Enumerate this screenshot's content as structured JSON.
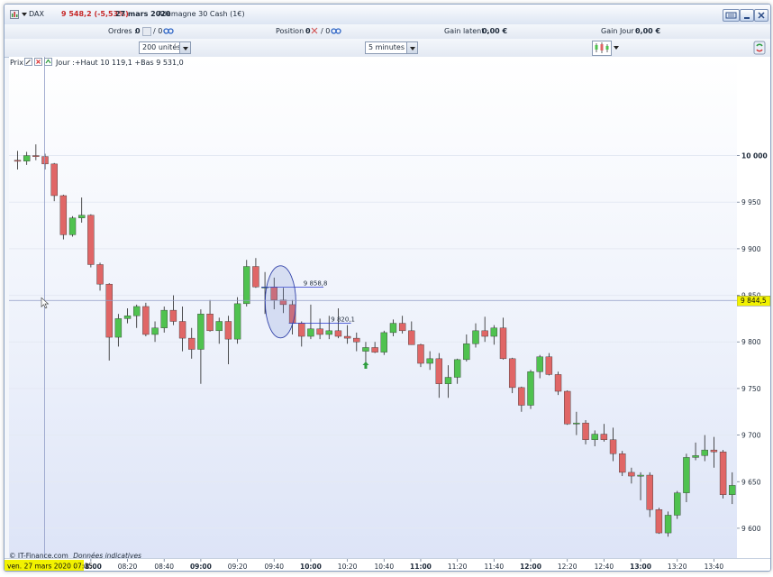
{
  "titlebar": {
    "symbol": "DAX",
    "price_change": "9 548,2 (-5,53%)",
    "date": "27 mars 2020",
    "instrument": "Allemagne 30 Cash (1€)"
  },
  "orders": {
    "label": "Ordres :",
    "value1": "0",
    "value2": "/ 0"
  },
  "position": {
    "label": "Position :",
    "value1": "0",
    "value2": "/ 0"
  },
  "gain_latent": {
    "label": "Gain latent :",
    "value": "0,00 €"
  },
  "gain_jour": {
    "label": "Gain Jour :",
    "value": "0,00 €"
  },
  "units_select": {
    "value": "200 unités"
  },
  "timeframe_select": {
    "value": "5 minutes"
  },
  "chart_header": {
    "label": "Prix",
    "info": "Jour :+Haut 10 119,1 +Bas 9 531,0"
  },
  "footer": {
    "copyright": "© IT-Finance.com",
    "note": "Données indicatives"
  },
  "colors": {
    "up": "#4fc24f",
    "down": "#e06666",
    "crosshair": "#8f9bc6",
    "current_price_bg": "#f2f200"
  },
  "chart_data": {
    "type": "candlestick",
    "title": "",
    "xlabel": "",
    "ylabel": "",
    "ylim": [
      9568,
      10106
    ],
    "y_ticks": [
      10000,
      9950,
      9900,
      9850,
      9800,
      9750,
      9700,
      9650,
      9600
    ],
    "y_tick_labels": [
      "10 000",
      "9 950",
      "9 900",
      "9 850",
      "9 800",
      "9 750",
      "9 700",
      "9 650",
      "9 600"
    ],
    "x_ticks": [
      {
        "label": "08:00",
        "bold": true,
        "idx": 8
      },
      {
        "label": "08:20",
        "bold": false,
        "idx": 12
      },
      {
        "label": "08:40",
        "bold": false,
        "idx": 16
      },
      {
        "label": "09:00",
        "bold": true,
        "idx": 20
      },
      {
        "label": "09:20",
        "bold": false,
        "idx": 24
      },
      {
        "label": "09:40",
        "bold": false,
        "idx": 28
      },
      {
        "label": "10:00",
        "bold": true,
        "idx": 32
      },
      {
        "label": "10:20",
        "bold": false,
        "idx": 36
      },
      {
        "label": "10:40",
        "bold": false,
        "idx": 40
      },
      {
        "label": "11:00",
        "bold": true,
        "idx": 44
      },
      {
        "label": "11:20",
        "bold": false,
        "idx": 48
      },
      {
        "label": "11:40",
        "bold": false,
        "idx": 52
      },
      {
        "label": "12:00",
        "bold": true,
        "idx": 56
      },
      {
        "label": "12:20",
        "bold": false,
        "idx": 60
      },
      {
        "label": "12:40",
        "bold": false,
        "idx": 64
      },
      {
        "label": "13:00",
        "bold": true,
        "idx": 68
      },
      {
        "label": "13:20",
        "bold": false,
        "idx": 72
      },
      {
        "label": "13:40",
        "bold": false,
        "idx": 76
      }
    ],
    "candles": [
      {
        "o": 9995,
        "h": 10005,
        "l": 9985,
        "c": 9994
      },
      {
        "o": 9994,
        "h": 10004,
        "l": 9990,
        "c": 10000
      },
      {
        "o": 10000,
        "h": 10012,
        "l": 9995,
        "c": 9999
      },
      {
        "o": 9999,
        "h": 10002,
        "l": 9985,
        "c": 9991
      },
      {
        "o": 9991,
        "h": 9992,
        "l": 9951,
        "c": 9957
      },
      {
        "o": 9957,
        "h": 9958,
        "l": 9910,
        "c": 9915
      },
      {
        "o": 9915,
        "h": 9935,
        "l": 9913,
        "c": 9933
      },
      {
        "o": 9933,
        "h": 9955,
        "l": 9928,
        "c": 9936
      },
      {
        "o": 9936,
        "h": 9937,
        "l": 9880,
        "c": 9883
      },
      {
        "o": 9883,
        "h": 9885,
        "l": 9855,
        "c": 9862
      },
      {
        "o": 9862,
        "h": 9863,
        "l": 9780,
        "c": 9805
      },
      {
        "o": 9805,
        "h": 9830,
        "l": 9795,
        "c": 9825
      },
      {
        "o": 9825,
        "h": 9836,
        "l": 9820,
        "c": 9828
      },
      {
        "o": 9828,
        "h": 9840,
        "l": 9815,
        "c": 9838
      },
      {
        "o": 9838,
        "h": 9842,
        "l": 9806,
        "c": 9808
      },
      {
        "o": 9808,
        "h": 9822,
        "l": 9800,
        "c": 9815
      },
      {
        "o": 9815,
        "h": 9838,
        "l": 9810,
        "c": 9834
      },
      {
        "o": 9834,
        "h": 9850,
        "l": 9818,
        "c": 9822
      },
      {
        "o": 9822,
        "h": 9838,
        "l": 9790,
        "c": 9804
      },
      {
        "o": 9804,
        "h": 9815,
        "l": 9782,
        "c": 9792
      },
      {
        "o": 9792,
        "h": 9835,
        "l": 9755,
        "c": 9830
      },
      {
        "o": 9830,
        "h": 9845,
        "l": 9811,
        "c": 9812
      },
      {
        "o": 9812,
        "h": 9826,
        "l": 9798,
        "c": 9822
      },
      {
        "o": 9822,
        "h": 9828,
        "l": 9776,
        "c": 9803
      },
      {
        "o": 9803,
        "h": 9848,
        "l": 9798,
        "c": 9841
      },
      {
        "o": 9841,
        "h": 9888,
        "l": 9838,
        "c": 9881
      },
      {
        "o": 9881,
        "h": 9890,
        "l": 9858,
        "c": 9859
      },
      {
        "o": 9859,
        "h": 9875,
        "l": 9830,
        "c": 9859
      },
      {
        "o": 9859,
        "h": 9869,
        "l": 9835,
        "c": 9845
      },
      {
        "o": 9845,
        "h": 9858,
        "l": 9831,
        "c": 9840
      },
      {
        "o": 9840,
        "h": 9845,
        "l": 9808,
        "c": 9820
      },
      {
        "o": 9820,
        "h": 9822,
        "l": 9795,
        "c": 9806
      },
      {
        "o": 9806,
        "h": 9840,
        "l": 9803,
        "c": 9814
      },
      {
        "o": 9814,
        "h": 9825,
        "l": 9803,
        "c": 9808
      },
      {
        "o": 9808,
        "h": 9828,
        "l": 9803,
        "c": 9812
      },
      {
        "o": 9812,
        "h": 9836,
        "l": 9804,
        "c": 9806
      },
      {
        "o": 9806,
        "h": 9818,
        "l": 9798,
        "c": 9804
      },
      {
        "o": 9804,
        "h": 9810,
        "l": 9790,
        "c": 9800
      },
      {
        "o": 9790,
        "h": 9800,
        "l": 9778,
        "c": 9794
      },
      {
        "o": 9794,
        "h": 9800,
        "l": 9788,
        "c": 9789
      },
      {
        "o": 9789,
        "h": 9812,
        "l": 9786,
        "c": 9810
      },
      {
        "o": 9810,
        "h": 9824,
        "l": 9806,
        "c": 9820
      },
      {
        "o": 9820,
        "h": 9828,
        "l": 9809,
        "c": 9812
      },
      {
        "o": 9812,
        "h": 9822,
        "l": 9797,
        "c": 9797
      },
      {
        "o": 9797,
        "h": 9798,
        "l": 9773,
        "c": 9777
      },
      {
        "o": 9777,
        "h": 9790,
        "l": 9770,
        "c": 9782
      },
      {
        "o": 9782,
        "h": 9788,
        "l": 9740,
        "c": 9755
      },
      {
        "o": 9755,
        "h": 9775,
        "l": 9740,
        "c": 9762
      },
      {
        "o": 9762,
        "h": 9782,
        "l": 9755,
        "c": 9781
      },
      {
        "o": 9781,
        "h": 9808,
        "l": 9779,
        "c": 9798
      },
      {
        "o": 9798,
        "h": 9820,
        "l": 9794,
        "c": 9812
      },
      {
        "o": 9812,
        "h": 9827,
        "l": 9800,
        "c": 9806
      },
      {
        "o": 9806,
        "h": 9818,
        "l": 9797,
        "c": 9815
      },
      {
        "o": 9815,
        "h": 9826,
        "l": 9781,
        "c": 9782
      },
      {
        "o": 9782,
        "h": 9783,
        "l": 9745,
        "c": 9751
      },
      {
        "o": 9751,
        "h": 9752,
        "l": 9725,
        "c": 9732
      },
      {
        "o": 9732,
        "h": 9770,
        "l": 9728,
        "c": 9768
      },
      {
        "o": 9768,
        "h": 9786,
        "l": 9761,
        "c": 9784
      },
      {
        "o": 9784,
        "h": 9788,
        "l": 9764,
        "c": 9765
      },
      {
        "o": 9765,
        "h": 9768,
        "l": 9743,
        "c": 9747
      },
      {
        "o": 9747,
        "h": 9748,
        "l": 9711,
        "c": 9712
      },
      {
        "o": 9712,
        "h": 9725,
        "l": 9700,
        "c": 9713
      },
      {
        "o": 9713,
        "h": 9716,
        "l": 9690,
        "c": 9695
      },
      {
        "o": 9695,
        "h": 9705,
        "l": 9688,
        "c": 9701
      },
      {
        "o": 9701,
        "h": 9712,
        "l": 9693,
        "c": 9695
      },
      {
        "o": 9695,
        "h": 9708,
        "l": 9672,
        "c": 9680
      },
      {
        "o": 9680,
        "h": 9683,
        "l": 9656,
        "c": 9660
      },
      {
        "o": 9660,
        "h": 9665,
        "l": 9648,
        "c": 9656
      },
      {
        "o": 9656,
        "h": 9660,
        "l": 9630,
        "c": 9657
      },
      {
        "o": 9657,
        "h": 9660,
        "l": 9612,
        "c": 9620
      },
      {
        "o": 9620,
        "h": 9622,
        "l": 9594,
        "c": 9595
      },
      {
        "o": 9595,
        "h": 9618,
        "l": 9591,
        "c": 9614
      },
      {
        "o": 9614,
        "h": 9640,
        "l": 9610,
        "c": 9638
      },
      {
        "o": 9638,
        "h": 9680,
        "l": 9628,
        "c": 9676
      },
      {
        "o": 9676,
        "h": 9692,
        "l": 9673,
        "c": 9678
      },
      {
        "o": 9678,
        "h": 9700,
        "l": 9672,
        "c": 9684
      },
      {
        "o": 9684,
        "h": 9698,
        "l": 9665,
        "c": 9682
      },
      {
        "o": 9682,
        "h": 9684,
        "l": 9632,
        "c": 9636
      },
      {
        "o": 9636,
        "h": 9660,
        "l": 9626,
        "c": 9646
      }
    ],
    "current_price_label": "9 844,5",
    "crosshair_time_label": "ven. 27 mars 2020 07:35",
    "annotations": [
      {
        "label": "9 858,8",
        "value": 9858.8
      },
      {
        "label": "9 820,1",
        "value": 9820.1
      }
    ]
  }
}
